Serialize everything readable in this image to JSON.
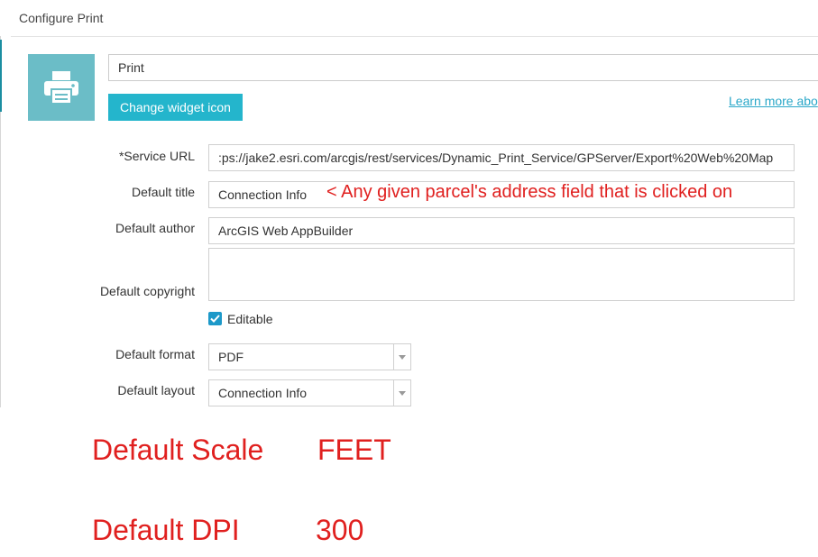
{
  "dialog": {
    "title": "Configure Print"
  },
  "widget": {
    "icon": "printer-icon",
    "name_value": "Print",
    "change_icon_label": "Change widget icon",
    "learn_more_label": "Learn more abo"
  },
  "form": {
    "service_url": {
      "label": "*Service URL",
      "value": ":ps://jake2.esri.com/arcgis/rest/services/Dynamic_Print_Service/GPServer/Export%20Web%20Map"
    },
    "default_title": {
      "label": "Default title",
      "value": "Connection Info"
    },
    "default_author": {
      "label": "Default author",
      "value": "ArcGIS Web AppBuilder"
    },
    "default_copyright": {
      "label": "Default copyright",
      "value": ""
    },
    "editable": {
      "label": "Editable",
      "checked": true
    },
    "default_format": {
      "label": "Default format",
      "value": "PDF"
    },
    "default_layout": {
      "label": "Default layout",
      "value": "Connection Info"
    }
  },
  "annotations": {
    "title_note": "< Any given parcel's address field that is clicked on",
    "scale_label": "Default Scale",
    "scale_value": "FEET",
    "dpi_label": "Default DPI",
    "dpi_value": "300"
  },
  "colors": {
    "accent": "#24b5cc",
    "icon_tile": "#6bbdc7",
    "annotation_red": "#e0201f",
    "link": "#2aa7c8",
    "checkbox": "#1d99c9"
  }
}
